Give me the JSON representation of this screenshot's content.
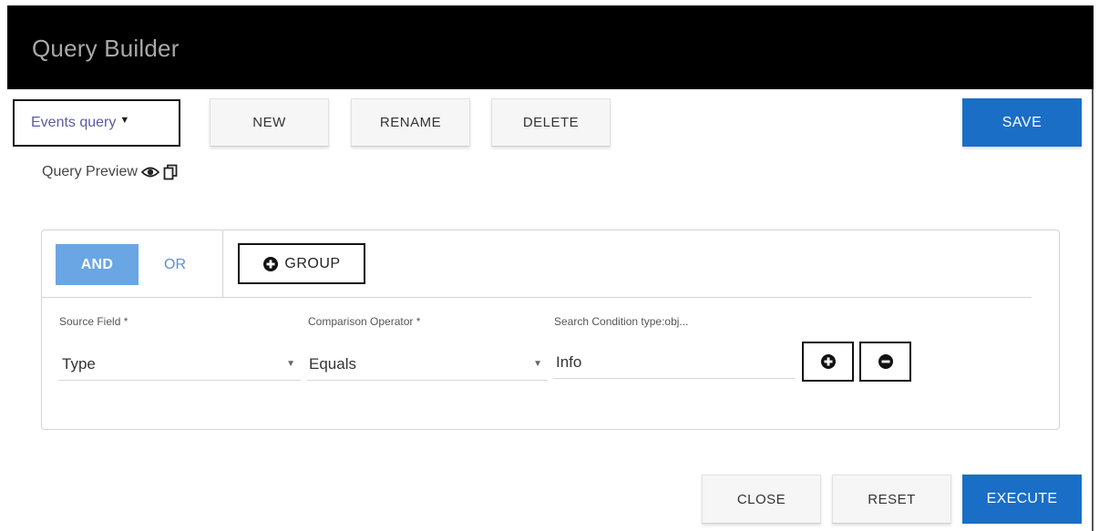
{
  "window": {
    "title": "Query Builder"
  },
  "toolbar": {
    "query_select": "Events query",
    "new_label": "NEW",
    "rename_label": "RENAME",
    "delete_label": "DELETE",
    "save_label": "SAVE"
  },
  "preview": {
    "label": "Query Preview"
  },
  "logic": {
    "and_label": "AND",
    "or_label": "OR",
    "group_label": "GROUP",
    "selected": "AND"
  },
  "condition": {
    "source_field_label": "Source Field *",
    "source_field_value": "Type",
    "operator_label": "Comparison Operator *",
    "operator_value": "Equals",
    "search_label": "Search Condition type:obj...",
    "search_value": "Info"
  },
  "footer": {
    "close_label": "CLOSE",
    "reset_label": "RESET",
    "execute_label": "EXECUTE"
  },
  "colors": {
    "primary": "#1a6ec6",
    "selected_toggle": "#6aa6e3",
    "header_bg": "#000000"
  },
  "icons": [
    "eye-icon",
    "copy-icon",
    "plus-circle-icon",
    "minus-circle-icon",
    "caret-down-icon"
  ]
}
